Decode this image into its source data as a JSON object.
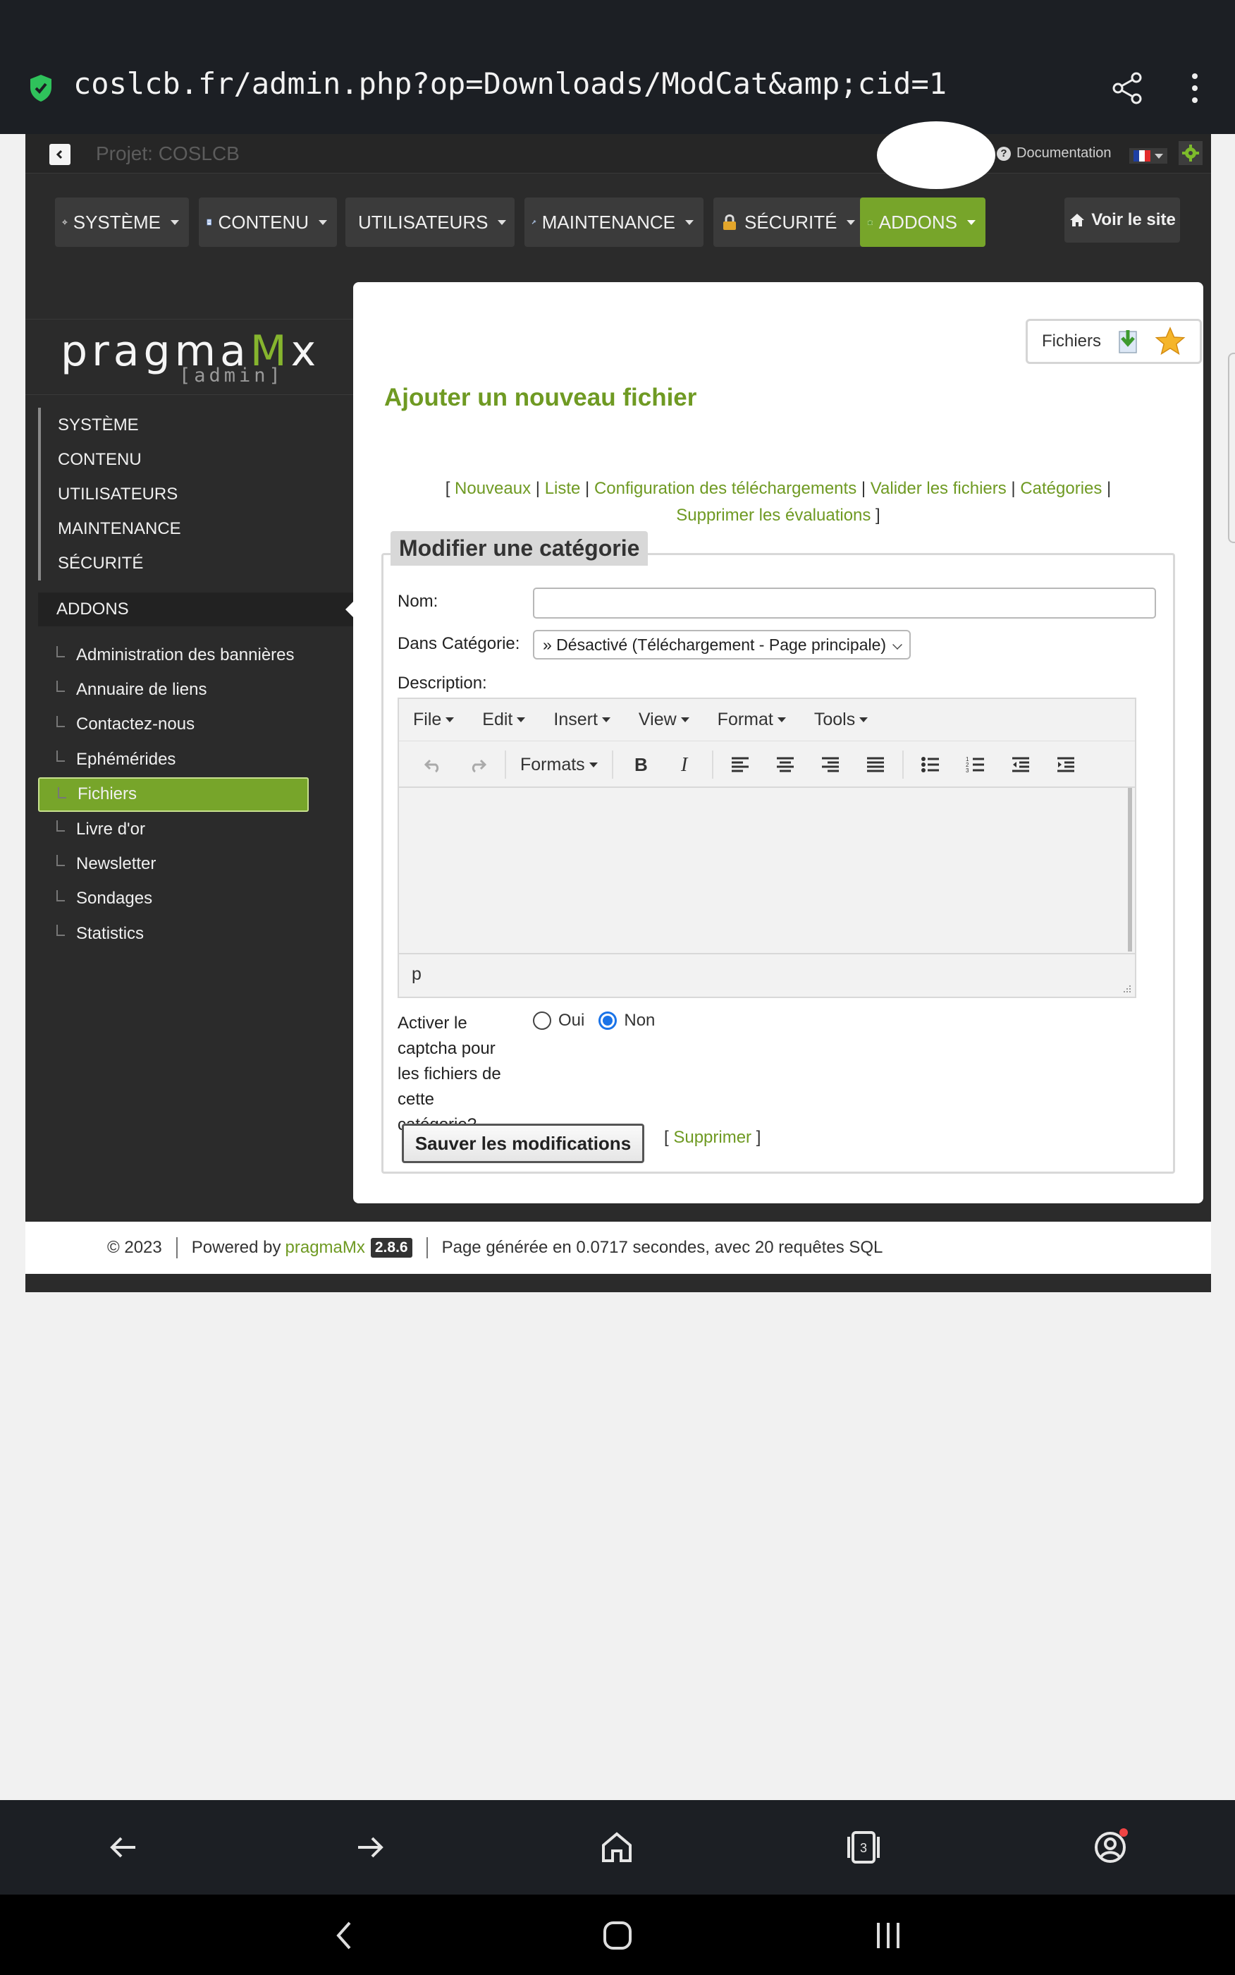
{
  "browser": {
    "url": "coslcb.fr/admin.php?op=Downloads/ModCat&amp;cid=1",
    "icons": [
      "secure-shield-icon",
      "share-icon",
      "more-vert-icon"
    ]
  },
  "topbar": {
    "project": "Projet: COSLCB",
    "documentation": "Documentation",
    "language_flag": "fr"
  },
  "mainnav": {
    "items": [
      {
        "label": "SYSTÈME",
        "icon": "gear-icon"
      },
      {
        "label": "CONTENU",
        "icon": "document-icon"
      },
      {
        "label": "UTILISATEURS",
        "icon": "user-icon"
      },
      {
        "label": "MAINTENANCE",
        "icon": "wrench-icon"
      },
      {
        "label": "SÉCURITÉ",
        "icon": "lock-icon"
      },
      {
        "label": "ADDONS",
        "icon": "puzzle-icon",
        "active": true
      }
    ],
    "site_link": "Voir le site"
  },
  "sidebar": {
    "logo_main_a": "pragma",
    "logo_main_m": "M",
    "logo_main_x": "x",
    "logo_sub": "[admin]",
    "groups": [
      "SYSTÈME",
      "CONTENU",
      "UTILISATEURS",
      "MAINTENANCE",
      "SÉCURITÉ"
    ],
    "addons": "ADDONS",
    "sub_items": [
      "Administration des bannières",
      "Annuaire de liens",
      "Contactez-nous",
      "Ephémérides",
      "Fichiers",
      "Livre d'or",
      "Newsletter",
      "Sondages",
      "Statistics"
    ],
    "active_sub": "Fichiers"
  },
  "content": {
    "module_badge": "Fichiers",
    "title": "Ajouter un nouveau fichier",
    "links": {
      "nouveaux": "Nouveaux",
      "liste": "Liste",
      "config": "Configuration des téléchargements",
      "valider": "Valider les fichiers",
      "categories": "Catégories",
      "supprimer_eval": "Supprimer les évaluations"
    },
    "form": {
      "legend": "Modifier une catégorie",
      "nom_label": "Nom:",
      "nom_value": "",
      "cat_label": "Dans Catégorie:",
      "cat_value": "» Désactivé (Téléchargement - Page principale)",
      "desc_label": "Description:",
      "editor_menu": [
        "File",
        "Edit",
        "Insert",
        "View",
        "Format",
        "Tools"
      ],
      "formats_label": "Formats",
      "status_path": "p",
      "captcha_label": "Activer le captcha pour les fichiers de cette catégorie?",
      "oui": "Oui",
      "non": "Non",
      "captcha_selected": "Non",
      "save": "Sauver les modifications",
      "delete": "Supprimer"
    }
  },
  "footer": {
    "copyright": "© 2023",
    "powered": "Powered by",
    "brand": "pragmaMx",
    "version": "2.8.6",
    "generated": "Page générée en 0.0717 secondes, avec 20 requêtes SQL"
  },
  "colors": {
    "accent": "#77a52a",
    "link": "#6f9a23",
    "dark": "#2b2b2b"
  }
}
